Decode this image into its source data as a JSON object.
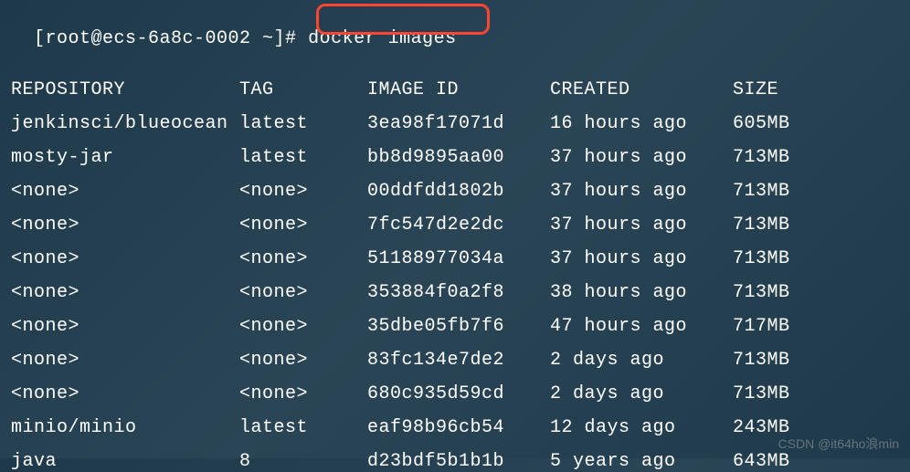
{
  "prompt": {
    "full": "[root@ecs-6a8c-0002 ~]# docker images"
  },
  "headers": {
    "repository": "REPOSITORY",
    "tag": "TAG",
    "image_id": "IMAGE ID",
    "created": "CREATED",
    "size": "SIZE"
  },
  "images": [
    {
      "repository": "jenkinsci/blueocean",
      "tag": "latest",
      "image_id": "3ea98f17071d",
      "created": "16 hours ago",
      "size": "605MB"
    },
    {
      "repository": "mosty-jar",
      "tag": "latest",
      "image_id": "bb8d9895aa00",
      "created": "37 hours ago",
      "size": "713MB"
    },
    {
      "repository": "<none>",
      "tag": "<none>",
      "image_id": "00ddfdd1802b",
      "created": "37 hours ago",
      "size": "713MB"
    },
    {
      "repository": "<none>",
      "tag": "<none>",
      "image_id": "7fc547d2e2dc",
      "created": "37 hours ago",
      "size": "713MB"
    },
    {
      "repository": "<none>",
      "tag": "<none>",
      "image_id": "51188977034a",
      "created": "37 hours ago",
      "size": "713MB"
    },
    {
      "repository": "<none>",
      "tag": "<none>",
      "image_id": "353884f0a2f8",
      "created": "38 hours ago",
      "size": "713MB"
    },
    {
      "repository": "<none>",
      "tag": "<none>",
      "image_id": "35dbe05fb7f6",
      "created": "47 hours ago",
      "size": "717MB"
    },
    {
      "repository": "<none>",
      "tag": "<none>",
      "image_id": "83fc134e7de2",
      "created": "2 days ago",
      "size": "713MB"
    },
    {
      "repository": "<none>",
      "tag": "<none>",
      "image_id": "680c935d59cd",
      "created": "2 days ago",
      "size": "713MB"
    },
    {
      "repository": "minio/minio",
      "tag": "latest",
      "image_id": "eaf98b96cb54",
      "created": "12 days ago",
      "size": "243MB"
    },
    {
      "repository": "java",
      "tag": "8",
      "image_id": "d23bdf5b1b1b",
      "created": "5 years ago",
      "size": "643MB"
    }
  ],
  "watermark": "CSDN @it64ho浪min"
}
